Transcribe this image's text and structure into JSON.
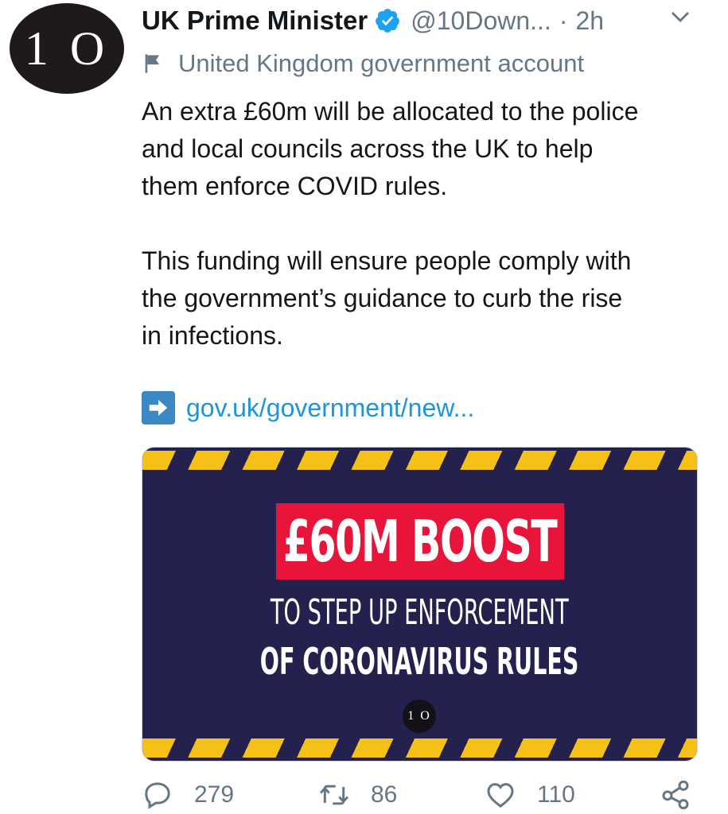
{
  "avatar": {
    "text": "1 O"
  },
  "header": {
    "name": "UK Prime Minister",
    "handle": "@10Down...",
    "separator": "·",
    "time": "2h",
    "icons": {
      "verified": "verified-badge-icon",
      "menu": "chevron-down-icon"
    }
  },
  "label": {
    "icon": "flag-icon",
    "text": "United Kingdom government account"
  },
  "tweet": {
    "paragraph1": "An extra £60m will be allocated to the police\nand local councils across the UK to help\nthem enforce COVID rules.",
    "paragraph2": "This funding will ensure people comply with\nthe government’s guidance to curb the rise\nin infections."
  },
  "link": {
    "icon": "right-arrow-icon",
    "text": "gov.uk/government/new..."
  },
  "card": {
    "headline": "£60M BOOST",
    "line1": "TO STEP UP ENFORCEMENT",
    "line2": "OF CORONAVIRUS RULES",
    "logo": "1 O",
    "colors": {
      "background": "#25214f",
      "stripe": "#f6c117",
      "banner": "#e8143a"
    }
  },
  "actions": {
    "reply": {
      "icon": "reply-icon",
      "count": "279"
    },
    "retweet": {
      "icon": "retweet-icon",
      "count": "86"
    },
    "like": {
      "icon": "heart-icon",
      "count": "110"
    },
    "share": {
      "icon": "share-icon"
    }
  },
  "colors": {
    "text": "#14171a",
    "muted": "#657786",
    "link": "#1b95e0",
    "verified": "#1da1f2"
  }
}
